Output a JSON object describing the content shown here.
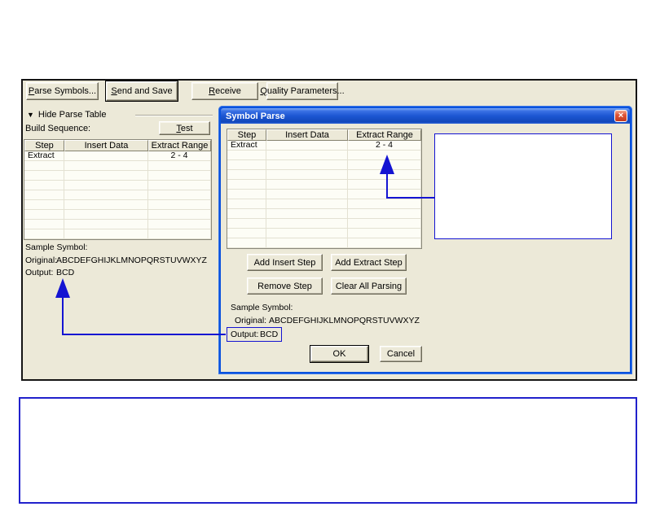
{
  "icons": {
    "collapse_triangle": "▼",
    "close": "×"
  },
  "colors": {
    "panel_beige": "#ece9d8",
    "annotation_blue": "#1414d2",
    "dialog_window_blue": "#0a52dd",
    "bottom_box_border_blue": "#2121cc",
    "close_button_red": "#c33a1e"
  },
  "toolbar": {
    "buttons": [
      {
        "mnemonic": "P",
        "rest": "arse Symbols..."
      },
      {
        "mnemonic": "S",
        "rest": "end and Save"
      },
      {
        "mnemonic": "R",
        "rest": "eceive"
      },
      {
        "mnemonic": "Q",
        "rest": "uality Parameters..."
      }
    ]
  },
  "left_panel": {
    "collapse_label": "Hide Parse Table",
    "build_sequence_label": "Build Sequence:",
    "test_button": {
      "mnemonic": "T",
      "rest": "est"
    },
    "table": {
      "headers": [
        "Step",
        "Insert Data",
        "Extract Range"
      ],
      "rows": [
        [
          "Extract",
          "",
          "2 - 4"
        ],
        [
          "",
          "",
          ""
        ],
        [
          "",
          "",
          ""
        ],
        [
          "",
          "",
          ""
        ],
        [
          "",
          "",
          ""
        ],
        [
          "",
          "",
          ""
        ],
        [
          "",
          "",
          ""
        ],
        [
          "",
          "",
          ""
        ],
        [
          "",
          "",
          ""
        ]
      ]
    },
    "sample": {
      "title": "Sample Symbol:",
      "original_label": "Original:",
      "original_value": "ABCDEFGHIJKLMNOPQRSTUVWXYZ",
      "output_label": "Output:",
      "output_value": "BCD"
    }
  },
  "dialog": {
    "title": "Symbol Parse",
    "table": {
      "headers": [
        "Step",
        "Insert Data",
        "Extract Range"
      ],
      "rows": [
        [
          "Extract",
          "",
          "2 - 4"
        ],
        [
          "",
          "",
          ""
        ],
        [
          "",
          "",
          ""
        ],
        [
          "",
          "",
          ""
        ],
        [
          "",
          "",
          ""
        ],
        [
          "",
          "",
          ""
        ],
        [
          "",
          "",
          ""
        ],
        [
          "",
          "",
          ""
        ],
        [
          "",
          "",
          ""
        ],
        [
          "",
          "",
          ""
        ],
        [
          "",
          "",
          ""
        ]
      ]
    },
    "action_buttons": [
      "Add Insert Step",
      "Add Extract Step",
      "Remove Step",
      "Clear All Parsing"
    ],
    "sample": {
      "title": "Sample Symbol:",
      "original_label": "Original:",
      "original_value": "ABCDEFGHIJKLMNOPQRSTUVWXYZ",
      "output_label": "Output:",
      "output_value": "BCD"
    },
    "ok_button": "OK",
    "cancel_button": "Cancel"
  }
}
